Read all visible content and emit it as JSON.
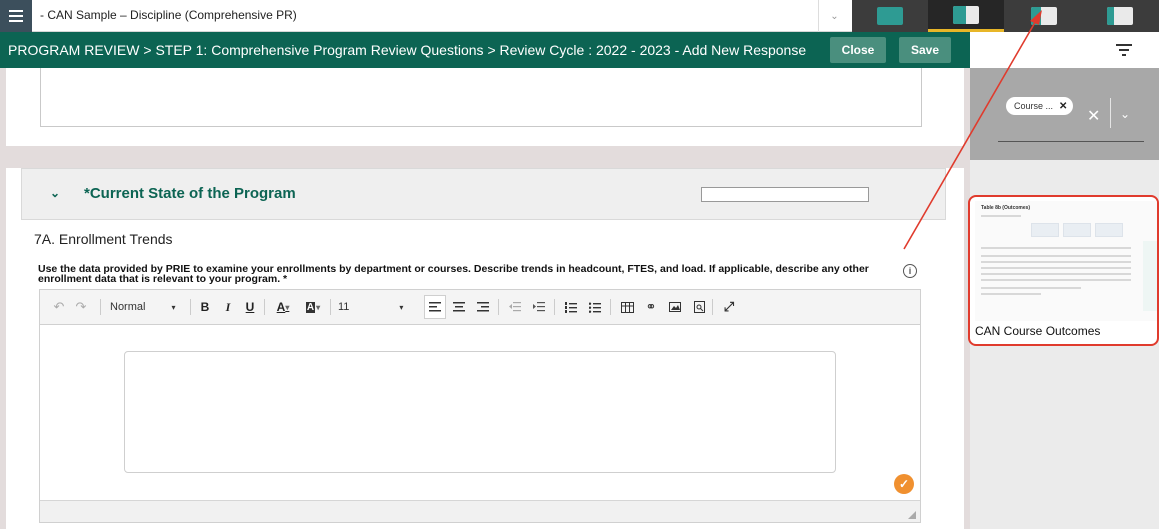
{
  "topbar": {
    "document_title": "- CAN Sample – Discipline (Comprehensive PR)",
    "layouts": [
      "full-panel-layout",
      "split-panel-layout",
      "narrow-split-layout",
      "wide-split-layout"
    ]
  },
  "header": {
    "breadcrumb": [
      "PROGRAM REVIEW",
      "STEP 1: Comprehensive Program Review Questions",
      "Review Cycle : 2022 - 2023 - Add New Response"
    ],
    "separator": ">",
    "close_label": "Close",
    "save_label": "Save"
  },
  "section": {
    "title": "*Current State of the Program"
  },
  "question": {
    "heading": "7A. Enrollment Trends",
    "text": "Use the data provided by PRIE to examine your enrollments by department or courses. Describe trends in headcount, FTES, and load. If applicable, describe any other enrollment data that is relevant to your program. *"
  },
  "toolbar": {
    "paragraph_style": "Normal",
    "font_size": "11",
    "bold": "B",
    "italic": "I",
    "underline": "U",
    "text_color": "A",
    "background_color": "A"
  },
  "right_panel": {
    "chip_label": "Course ...",
    "chip_remove": "✕",
    "clear_all": "✕",
    "card_title": "CAN Course Outcomes",
    "thumb_title": "Table 8b (Outcomes)"
  },
  "colors": {
    "brand_green": "#0c6453",
    "button_green": "#4a8f7e",
    "accent_orange": "#f0902f",
    "annotation_red": "#e03b2d",
    "active_tab_underline": "#e8b628"
  },
  "icons": {
    "menu": "hamburger-icon",
    "filter": "filter-icon",
    "info": "info-icon",
    "check": "check-icon",
    "section": "chevron-down-icon"
  }
}
